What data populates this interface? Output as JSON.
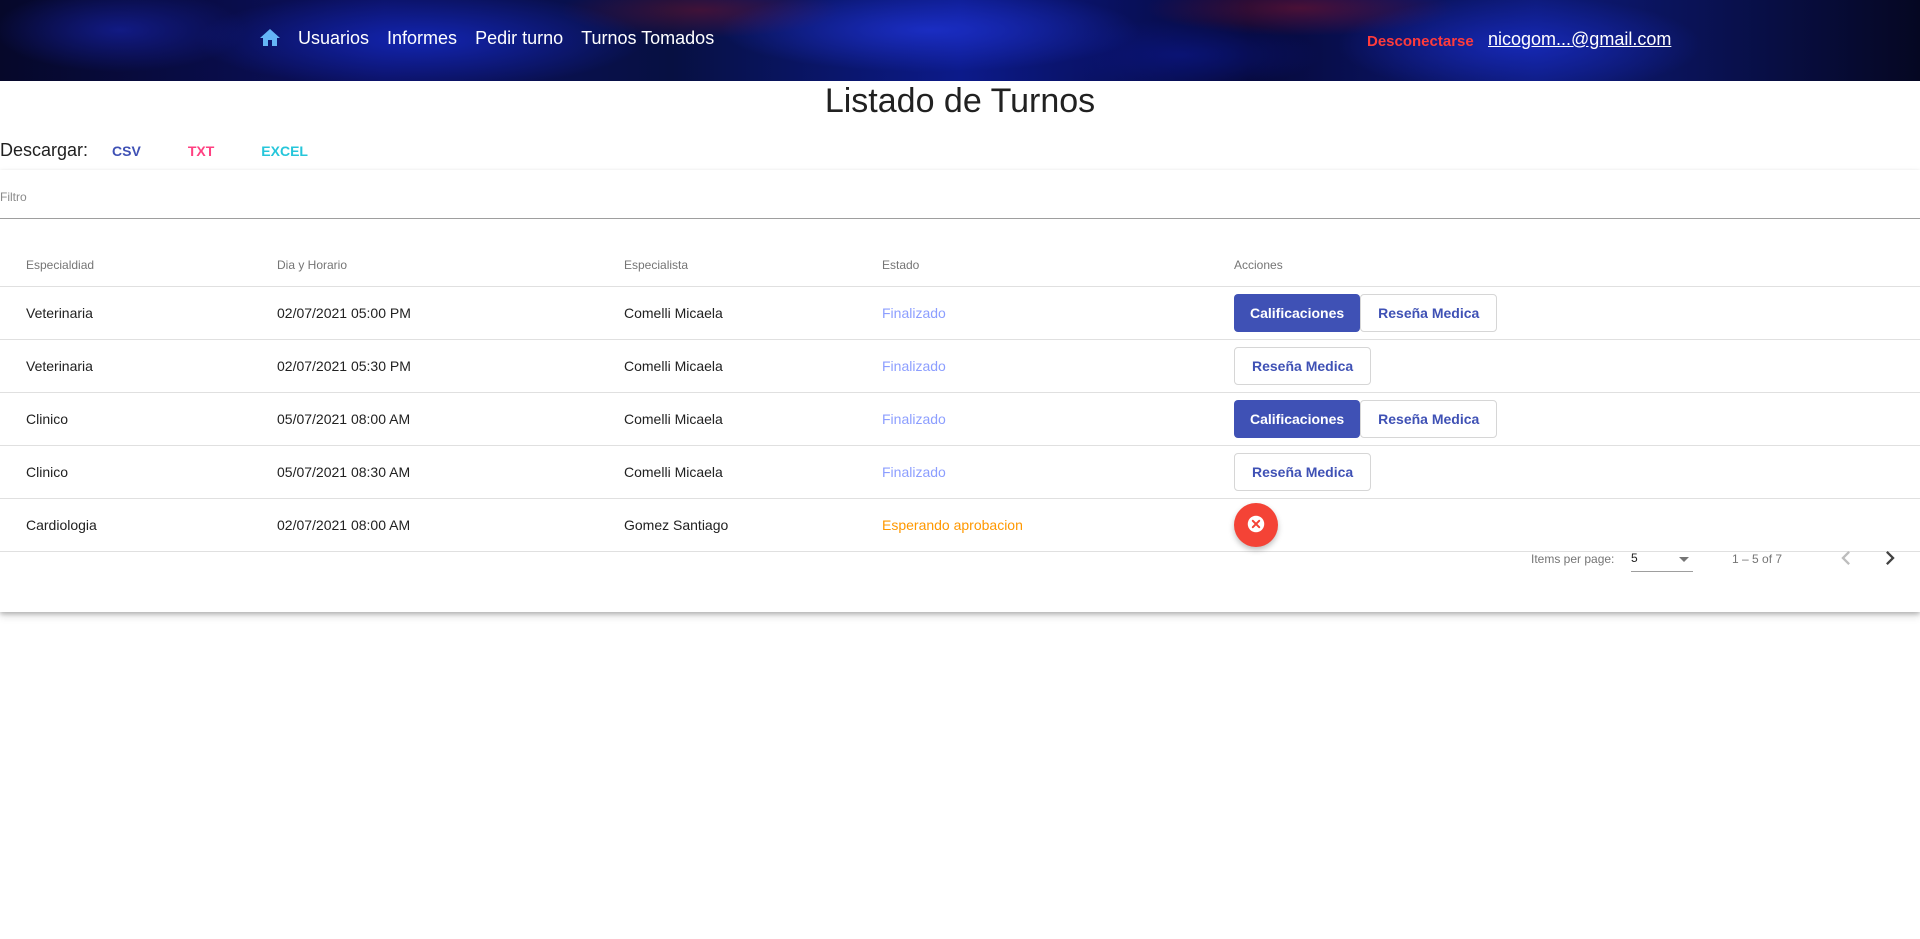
{
  "nav": {
    "home_icon": "home-icon",
    "links": [
      "Usuarios",
      "Informes",
      "Pedir turno",
      "Turnos Tomados"
    ],
    "logout": "Desconectarse",
    "user_email": " nicogom...@gmail.com"
  },
  "page": {
    "title": "Listado de Turnos",
    "download_label": "Descargar:",
    "download": {
      "csv": "CSV",
      "txt": "TXT",
      "excel": "EXCEL"
    }
  },
  "filter": {
    "placeholder": "Filtro",
    "value": ""
  },
  "table": {
    "headers": [
      "Especialdiad",
      "Dia y Horario",
      "Especialista",
      "Estado",
      "Acciones"
    ],
    "rows": [
      {
        "especialidad": "Veterinaria",
        "fecha": "02/07/2021 05:00 PM",
        "especialista": "Comelli Micaela",
        "estado": "Finalizado",
        "actions": [
          "Calificaciones",
          "Reseña Medica"
        ]
      },
      {
        "especialidad": "Veterinaria",
        "fecha": "02/07/2021 05:30 PM",
        "especialista": "Comelli Micaela",
        "estado": "Finalizado",
        "actions": [
          "Reseña Medica"
        ]
      },
      {
        "especialidad": "Clinico",
        "fecha": "05/07/2021 08:00 AM",
        "especialista": "Comelli Micaela",
        "estado": "Finalizado",
        "actions": [
          "Calificaciones",
          "Reseña Medica"
        ]
      },
      {
        "especialidad": "Clinico",
        "fecha": "05/07/2021 08:30 AM",
        "especialista": "Comelli Micaela",
        "estado": "Finalizado",
        "actions": [
          "Reseña Medica"
        ]
      },
      {
        "especialidad": "Cardiologia",
        "fecha": "02/07/2021 08:00 AM",
        "especialista": "Gomez Santiago",
        "estado": "Esperando aprobacion",
        "actions": [
          "cancel-icon"
        ]
      }
    ]
  },
  "paginator": {
    "items_per_page_label": "Items per page:",
    "items_per_page": "5",
    "range": "1 – 5 of 7"
  },
  "colors": {
    "primary": "#3f51b5",
    "accent": "#ff4081",
    "excel": "#26c6da",
    "logout": "#ff3b3b",
    "status_finalizado": "#8c9eff",
    "status_esperando": "#ff9800",
    "cancel": "#f44336"
  }
}
